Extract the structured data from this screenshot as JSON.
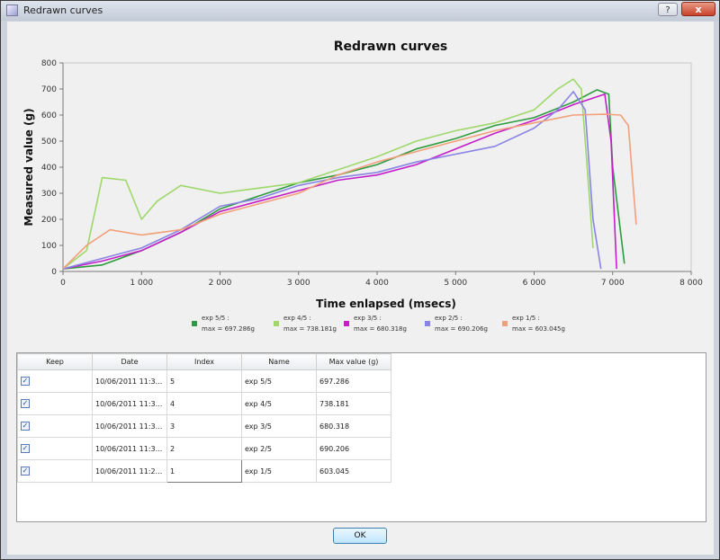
{
  "window": {
    "title": "Redrawn curves",
    "help_label": "?",
    "close_label": "x"
  },
  "chart_data": {
    "type": "line",
    "title": "Redrawn curves",
    "xlabel": "Time enlapsed (msecs)",
    "ylabel": "Measured value (g)",
    "xlim": [
      0,
      8000
    ],
    "ylim": [
      0,
      800
    ],
    "x_ticks": [
      "0",
      "1 000",
      "2 000",
      "3 000",
      "4 000",
      "5 000",
      "6 000",
      "7 000",
      "8 000"
    ],
    "y_ticks": [
      "0",
      "100",
      "200",
      "300",
      "400",
      "500",
      "600",
      "700",
      "800"
    ],
    "grid": false,
    "legend_position": "bottom",
    "series": [
      {
        "name": "exp 5/5 :",
        "max_label": "max = 697.286g",
        "color": "#2e9b3e",
        "points": [
          [
            0,
            10
          ],
          [
            500,
            25
          ],
          [
            1000,
            80
          ],
          [
            1500,
            150
          ],
          [
            2000,
            240
          ],
          [
            2500,
            290
          ],
          [
            3000,
            340
          ],
          [
            3500,
            370
          ],
          [
            4000,
            410
          ],
          [
            4500,
            470
          ],
          [
            5000,
            510
          ],
          [
            5500,
            560
          ],
          [
            6000,
            590
          ],
          [
            6500,
            650
          ],
          [
            6800,
            697
          ],
          [
            6950,
            680
          ],
          [
            7000,
            400
          ],
          [
            7150,
            30
          ]
        ]
      },
      {
        "name": "exp 4/5 :",
        "max_label": "max = 738.181g",
        "color": "#9ed86a",
        "points": [
          [
            0,
            10
          ],
          [
            300,
            80
          ],
          [
            500,
            360
          ],
          [
            800,
            350
          ],
          [
            1000,
            200
          ],
          [
            1200,
            270
          ],
          [
            1500,
            330
          ],
          [
            2000,
            300
          ],
          [
            2500,
            320
          ],
          [
            3000,
            340
          ],
          [
            3500,
            390
          ],
          [
            4000,
            440
          ],
          [
            4500,
            500
          ],
          [
            5000,
            540
          ],
          [
            5500,
            570
          ],
          [
            6000,
            620
          ],
          [
            6300,
            700
          ],
          [
            6500,
            738
          ],
          [
            6600,
            700
          ],
          [
            6700,
            300
          ],
          [
            6750,
            90
          ]
        ]
      },
      {
        "name": "exp 3/5 :",
        "max_label": "max = 680.318g",
        "color": "#c31ec8",
        "points": [
          [
            0,
            10
          ],
          [
            500,
            40
          ],
          [
            1000,
            80
          ],
          [
            1500,
            150
          ],
          [
            2000,
            230
          ],
          [
            2500,
            270
          ],
          [
            3000,
            310
          ],
          [
            3500,
            350
          ],
          [
            4000,
            370
          ],
          [
            4500,
            410
          ],
          [
            5000,
            470
          ],
          [
            5500,
            530
          ],
          [
            6000,
            580
          ],
          [
            6500,
            640
          ],
          [
            6900,
            680
          ],
          [
            6980,
            500
          ],
          [
            7050,
            10
          ]
        ]
      },
      {
        "name": "exp 2/5 :",
        "max_label": "max = 690.206g",
        "color": "#8a83e6",
        "points": [
          [
            0,
            10
          ],
          [
            500,
            50
          ],
          [
            1000,
            90
          ],
          [
            1500,
            160
          ],
          [
            2000,
            250
          ],
          [
            2500,
            280
          ],
          [
            3000,
            330
          ],
          [
            3500,
            360
          ],
          [
            4000,
            380
          ],
          [
            4500,
            420
          ],
          [
            5000,
            450
          ],
          [
            5500,
            480
          ],
          [
            6000,
            550
          ],
          [
            6300,
            620
          ],
          [
            6500,
            690
          ],
          [
            6650,
            620
          ],
          [
            6750,
            200
          ],
          [
            6850,
            10
          ]
        ]
      },
      {
        "name": "exp 1/5 :",
        "max_label": "max = 603.045g",
        "color": "#f2a07b",
        "points": [
          [
            0,
            10
          ],
          [
            300,
            100
          ],
          [
            600,
            160
          ],
          [
            1000,
            140
          ],
          [
            1500,
            160
          ],
          [
            2000,
            220
          ],
          [
            2500,
            260
          ],
          [
            3000,
            300
          ],
          [
            3500,
            370
          ],
          [
            4000,
            420
          ],
          [
            4500,
            460
          ],
          [
            5000,
            500
          ],
          [
            5500,
            540
          ],
          [
            6000,
            570
          ],
          [
            6500,
            600
          ],
          [
            6900,
            603
          ],
          [
            7100,
            600
          ],
          [
            7200,
            560
          ],
          [
            7300,
            180
          ]
        ]
      }
    ]
  },
  "table": {
    "headers": [
      "Keep",
      "Date",
      "Index",
      "Name",
      "Max value (g)"
    ],
    "rows": [
      {
        "keep": "✓",
        "date": "10/06/2011 11:3...",
        "index": "5",
        "name": "exp 5/5",
        "max": "697.286"
      },
      {
        "keep": "✓",
        "date": "10/06/2011 11:3...",
        "index": "4",
        "name": "exp 4/5",
        "max": "738.181"
      },
      {
        "keep": "✓",
        "date": "10/06/2011 11:3...",
        "index": "3",
        "name": "exp 3/5",
        "max": "680.318"
      },
      {
        "keep": "✓",
        "date": "10/06/2011 11:3...",
        "index": "2",
        "name": "exp 2/5",
        "max": "690.206"
      },
      {
        "keep": "✓",
        "date": "10/06/2011 11:2...",
        "index": "1",
        "name": "exp 1/5",
        "max": "603.045"
      }
    ]
  },
  "ok_label": "OK"
}
